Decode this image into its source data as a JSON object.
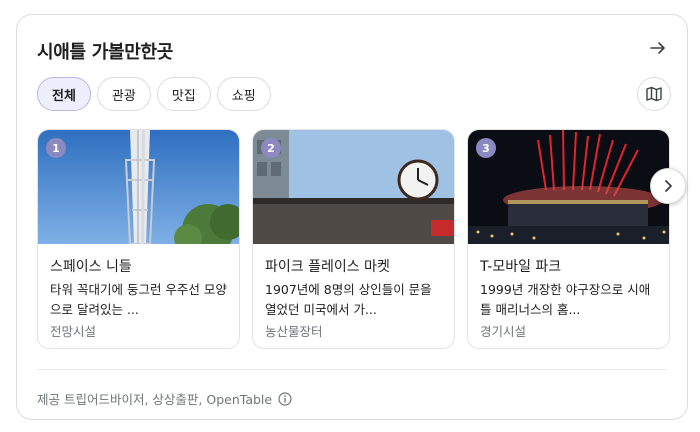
{
  "header": {
    "title": "시애틀 가볼만한곳",
    "arrow_icon": "arrow-right-icon"
  },
  "chips": [
    {
      "label": "전체",
      "active": true
    },
    {
      "label": "관광",
      "active": false
    },
    {
      "label": "맛집",
      "active": false
    },
    {
      "label": "쇼핑",
      "active": false
    }
  ],
  "map_icon": "map-icon",
  "cards": [
    {
      "rank": "1",
      "name": "스페이스 니들",
      "description": "타워 꼭대기에 둥그런 우주선 모양으로 달려있는 ...",
      "category": "전망시설"
    },
    {
      "rank": "2",
      "name": "파이크 플레이스 마켓",
      "description": "1907년에 8명의 상인들이 문을 열었던 미국에서 가...",
      "category": "농산물장터"
    },
    {
      "rank": "3",
      "name": "T-모바일 파크",
      "description": "1999년 개장한 야구장으로 시애틀 매리너스의 홈...",
      "category": "경기시설"
    }
  ],
  "next_icon": "chevron-right-icon",
  "footer": {
    "source": "제공  트립어드바이저, 상상출판, OpenTable",
    "info_icon": "info-icon"
  },
  "colors": {
    "accent_chip_bg": "#eeeefc",
    "rank_badge": "#8a8ac0",
    "muted_text": "#70757a"
  }
}
